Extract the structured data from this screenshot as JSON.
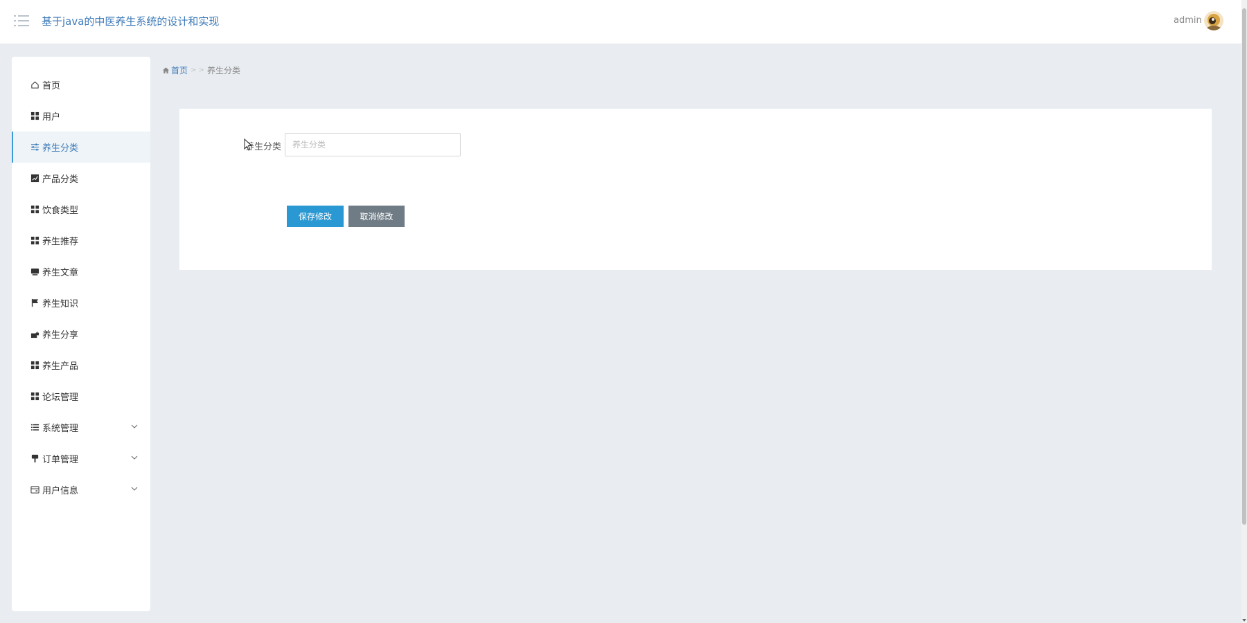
{
  "header": {
    "title": "基于java的中医养生系统的设计和实现",
    "user": "admin"
  },
  "sidebar": {
    "items": [
      {
        "label": "首页",
        "icon": "home-icon"
      },
      {
        "label": "用户",
        "icon": "grid-icon"
      },
      {
        "label": "养生分类",
        "icon": "sliders-icon",
        "active": true
      },
      {
        "label": "产品分类",
        "icon": "chart-icon"
      },
      {
        "label": "饮食类型",
        "icon": "grid-icon"
      },
      {
        "label": "养生推荐",
        "icon": "grid-icon"
      },
      {
        "label": "养生文章",
        "icon": "monitor-icon"
      },
      {
        "label": "养生知识",
        "icon": "flag-icon"
      },
      {
        "label": "养生分享",
        "icon": "share-icon"
      },
      {
        "label": "养生产品",
        "icon": "grid-icon"
      },
      {
        "label": "论坛管理",
        "icon": "grid-icon"
      },
      {
        "label": "系统管理",
        "icon": "list-icon",
        "expandable": true
      },
      {
        "label": "订单管理",
        "icon": "brush-icon",
        "expandable": true
      },
      {
        "label": "用户信息",
        "icon": "card-icon",
        "expandable": true
      }
    ]
  },
  "breadcrumb": {
    "home": "首页",
    "separator": "> >",
    "current": "养生分类"
  },
  "form": {
    "label": "养生分类",
    "input_value": "",
    "input_placeholder": "养生分类",
    "save_label": "保存修改",
    "cancel_label": "取消修改"
  },
  "colors": {
    "accent": "#2a98d2",
    "title": "#3d7ab8",
    "cancel": "#6f7c85",
    "background": "#e9edf1"
  }
}
